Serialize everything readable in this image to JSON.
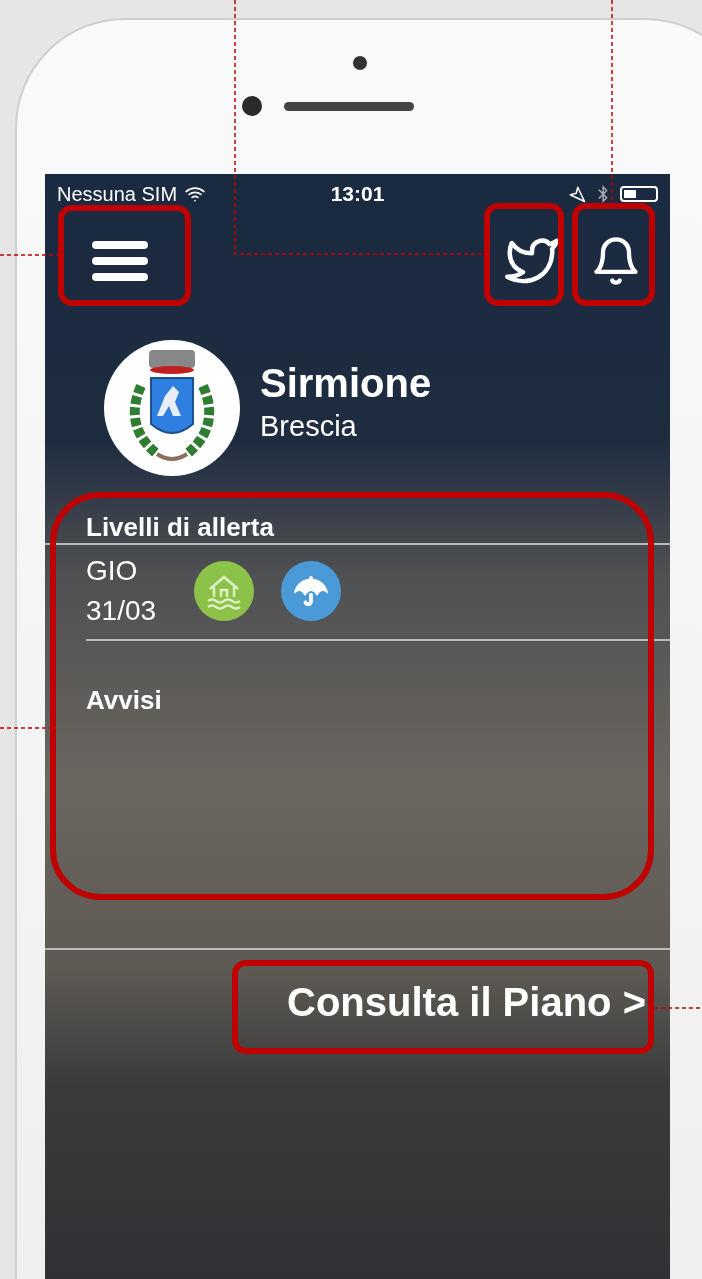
{
  "status_bar": {
    "carrier": "Nessuna SIM",
    "time": "13:01"
  },
  "town": {
    "name": "Sirmione",
    "province": "Brescia"
  },
  "alert_section": {
    "title": "Livelli di allerta",
    "day": "GIO",
    "date": "31/03",
    "alerts": [
      {
        "kind": "flood",
        "color": "#8cc24a"
      },
      {
        "kind": "rain",
        "color": "#4a9ad8"
      }
    ]
  },
  "notices": {
    "title": "Avvisi"
  },
  "plan_button": {
    "label": "Consulta il Piano >"
  }
}
